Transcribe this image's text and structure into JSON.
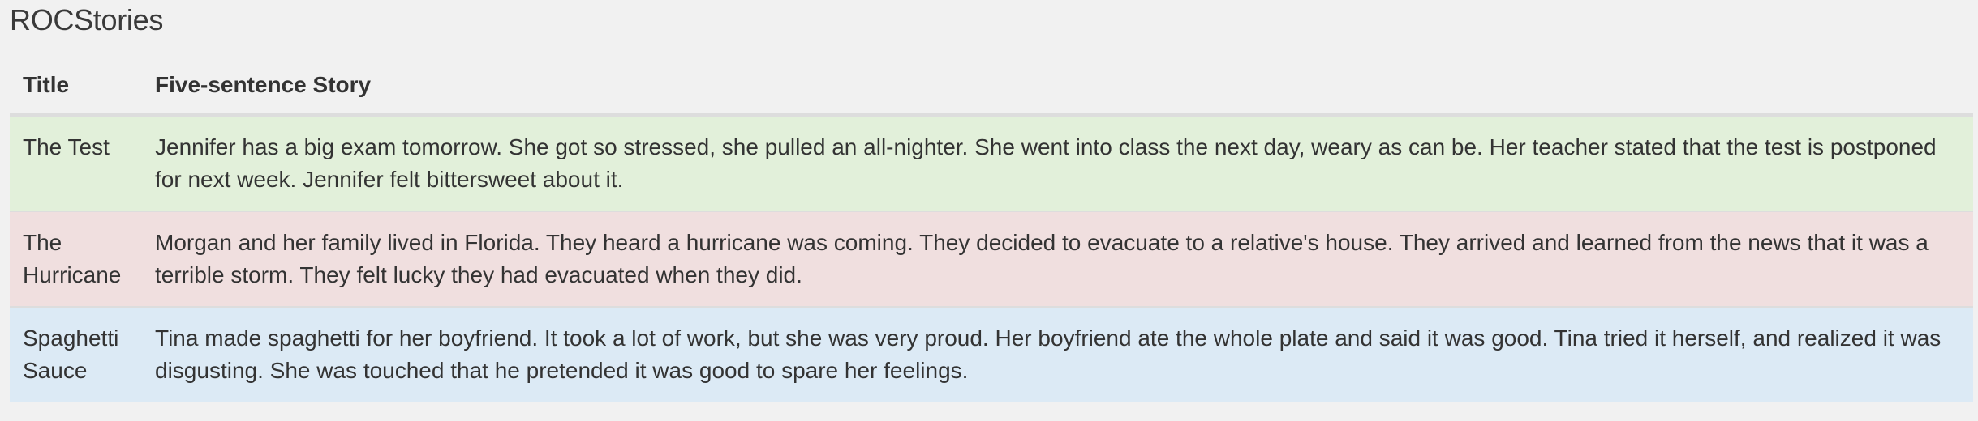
{
  "page": {
    "title": "ROCStories"
  },
  "table": {
    "headers": {
      "title": "Title",
      "story": "Five-sentence Story"
    },
    "rows": [
      {
        "title": "The Test",
        "story": "Jennifer has a big exam tomorrow. She got so stressed, she pulled an all-nighter. She went into class the next day, weary as can be. Her teacher stated that the test is postponed for next week. Jennifer felt bittersweet about it.",
        "color": "#e2f0da"
      },
      {
        "title": "The Hurricane",
        "story": "Morgan and her family lived in Florida. They heard a hurricane was coming. They decided to evacuate to a relative's house. They arrived and learned from the news that it was a terrible storm. They felt lucky they had evacuated when they did.",
        "color": "#f0dfdf"
      },
      {
        "title": "Spaghetti Sauce",
        "story": "Tina made spaghetti for her boyfriend. It took a lot of work, but she was very proud. Her boyfriend ate the whole plate and said it was good. Tina tried it herself, and realized it was disgusting. She was touched that he pretended it was good to spare her feelings.",
        "color": "#dceaf5"
      }
    ]
  }
}
